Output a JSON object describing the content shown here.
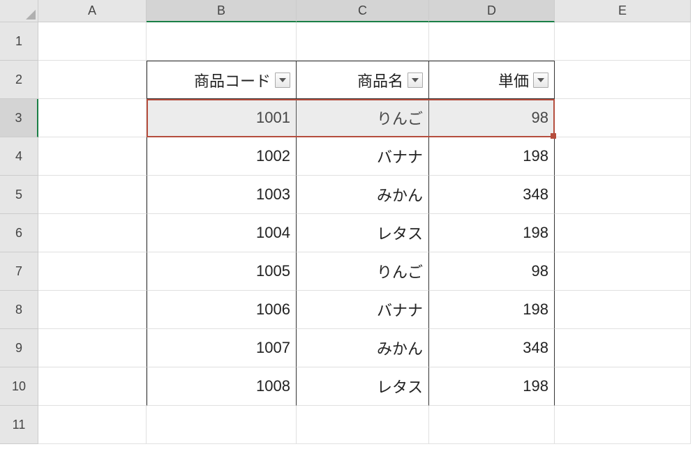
{
  "columns": [
    "A",
    "B",
    "C",
    "D",
    "E"
  ],
  "rows": [
    "1",
    "2",
    "3",
    "4",
    "5",
    "6",
    "7",
    "8",
    "9",
    "10",
    "11"
  ],
  "headers": {
    "col_b": "商品コード",
    "col_c": "商品名",
    "col_d": "単価"
  },
  "data": [
    {
      "code": "1001",
      "name": "りんご",
      "price": "98"
    },
    {
      "code": "1002",
      "name": "バナナ",
      "price": "198"
    },
    {
      "code": "1003",
      "name": "みかん",
      "price": "348"
    },
    {
      "code": "1004",
      "name": "レタス",
      "price": "198"
    },
    {
      "code": "1005",
      "name": "りんご",
      "price": "98"
    },
    {
      "code": "1006",
      "name": "バナナ",
      "price": "198"
    },
    {
      "code": "1007",
      "name": "みかん",
      "price": "348"
    },
    {
      "code": "1008",
      "name": "レタス",
      "price": "198"
    }
  ],
  "selection": {
    "active_row": "3",
    "active_cols": [
      "B",
      "C",
      "D"
    ]
  }
}
